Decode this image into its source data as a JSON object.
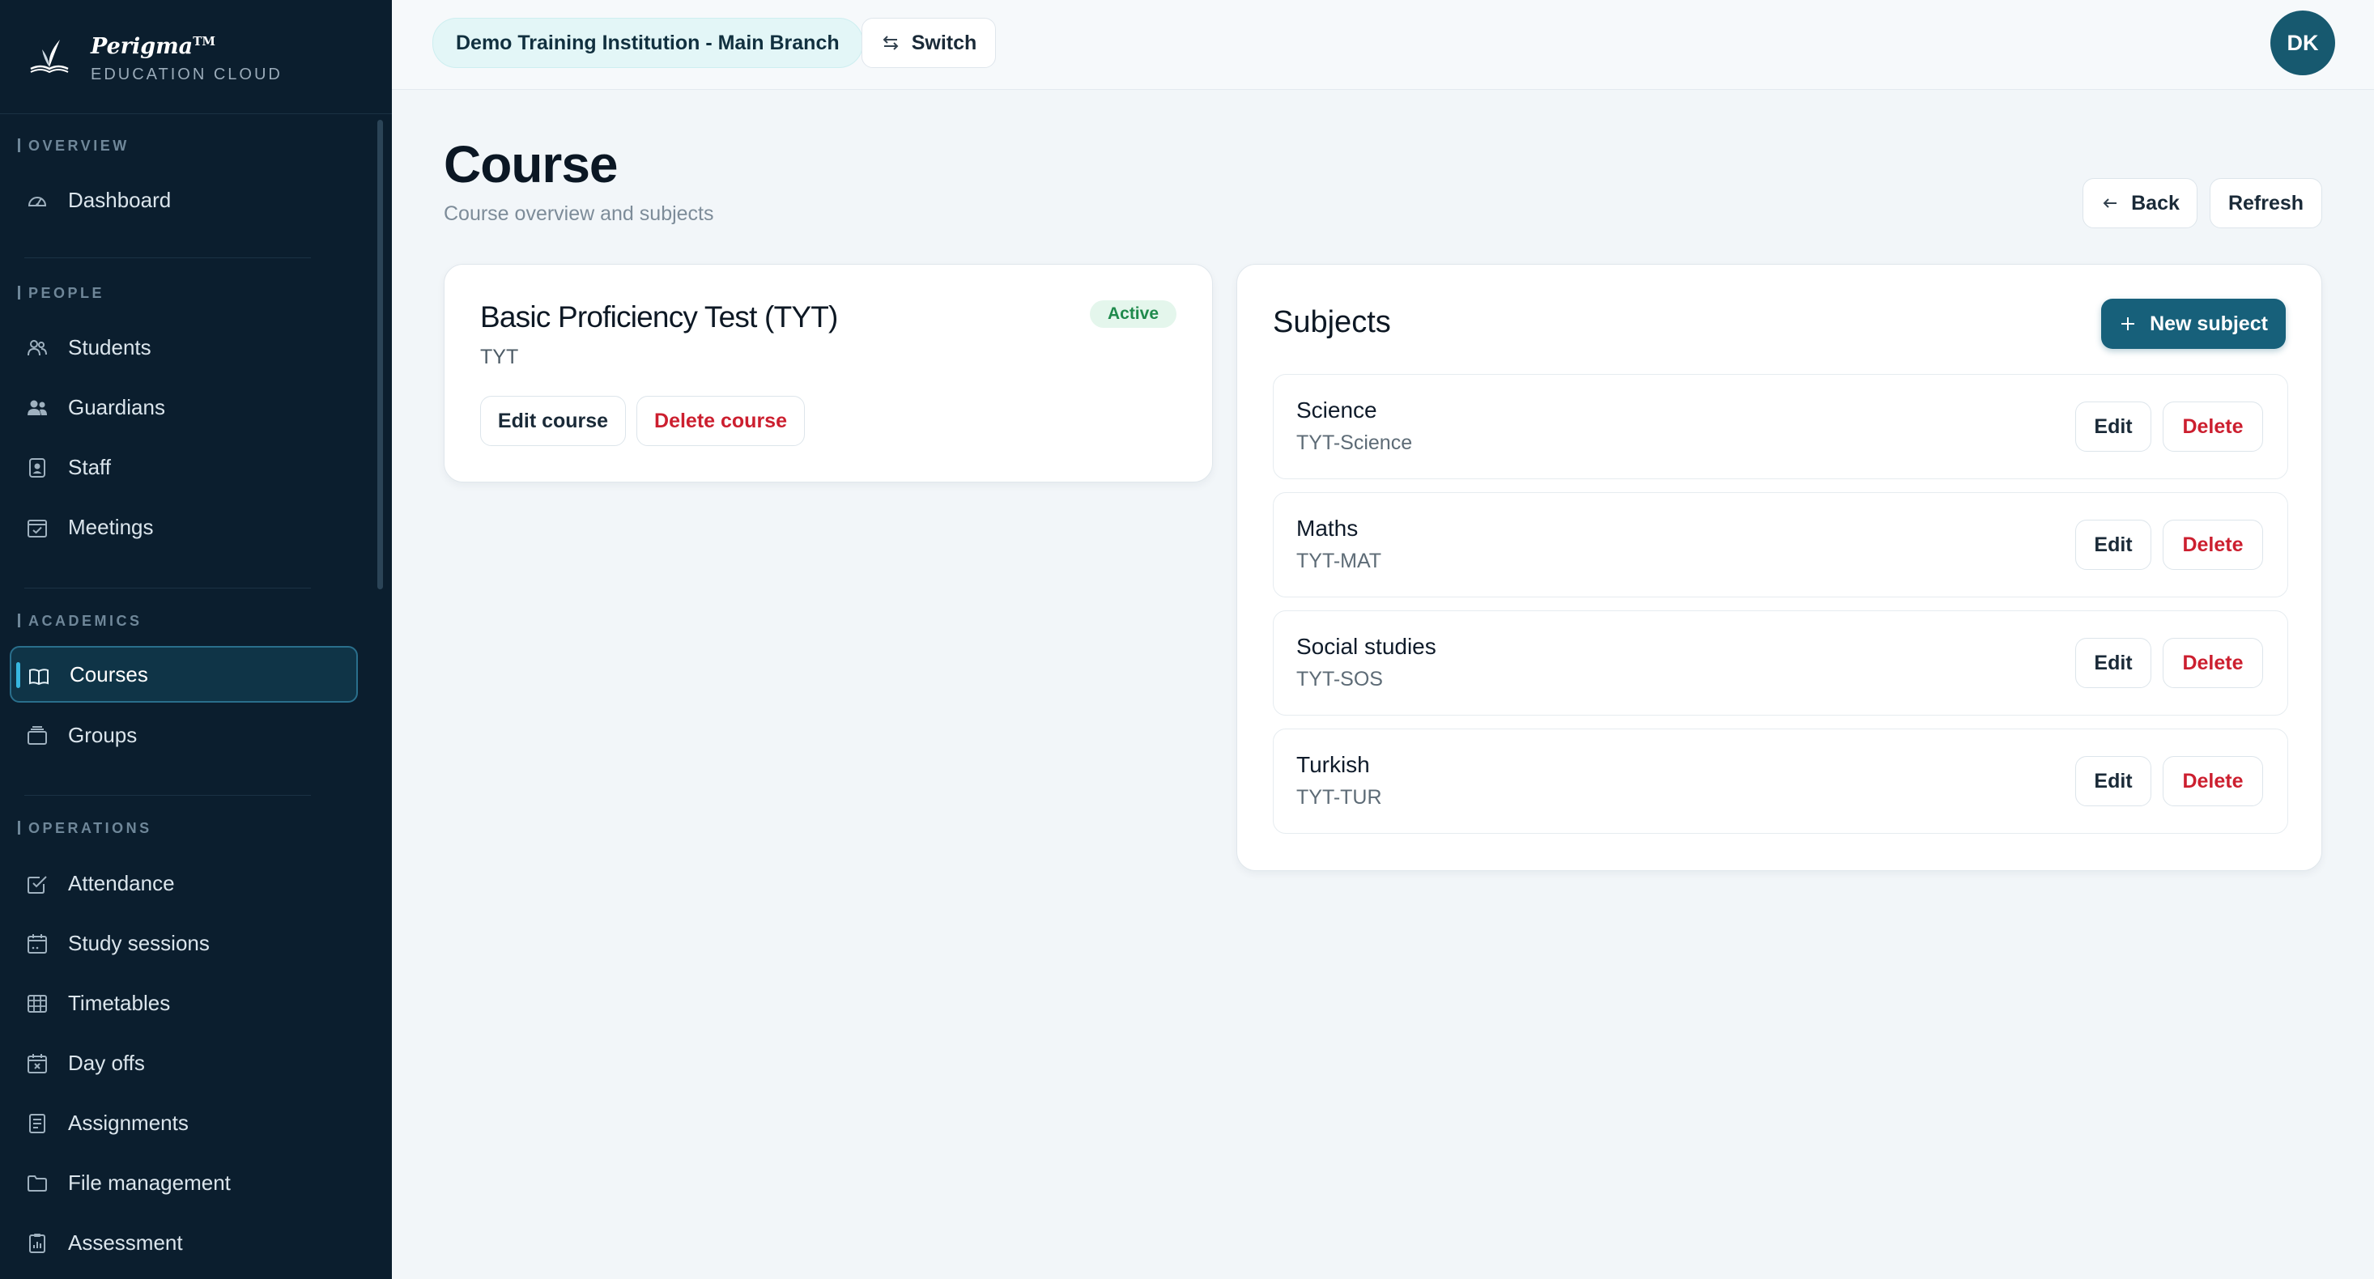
{
  "brand": {
    "name": "Perigma",
    "trademark": "TM",
    "subtitle": "EDUCATION CLOUD"
  },
  "sidebar": {
    "sections": [
      {
        "title": "OVERVIEW",
        "items": [
          {
            "label": "Dashboard",
            "icon": "gauge-icon"
          }
        ]
      },
      {
        "title": "PEOPLE",
        "items": [
          {
            "label": "Students",
            "icon": "users-icon"
          },
          {
            "label": "Guardians",
            "icon": "guardians-icon"
          },
          {
            "label": "Staff",
            "icon": "badge-icon"
          },
          {
            "label": "Meetings",
            "icon": "calendar-check-icon"
          }
        ]
      },
      {
        "title": "ACADEMICS",
        "items": [
          {
            "label": "Courses",
            "icon": "book-open-icon",
            "active": true
          },
          {
            "label": "Groups",
            "icon": "folder-stack-icon"
          }
        ]
      },
      {
        "title": "OPERATIONS",
        "items": [
          {
            "label": "Attendance",
            "icon": "check-square-icon"
          },
          {
            "label": "Study sessions",
            "icon": "calendar-icon"
          },
          {
            "label": "Timetables",
            "icon": "grid-icon"
          },
          {
            "label": "Day offs",
            "icon": "calendar-x-icon"
          },
          {
            "label": "Assignments",
            "icon": "list-doc-icon"
          },
          {
            "label": "File management",
            "icon": "folder-icon"
          },
          {
            "label": "Assessment",
            "icon": "clipboard-chart-icon"
          }
        ]
      }
    ]
  },
  "topbar": {
    "institution": "Demo Training Institution - Main Branch",
    "switch_label": "Switch",
    "avatar_initials": "DK"
  },
  "page": {
    "title": "Course",
    "subtitle": "Course overview and subjects",
    "back_label": "Back",
    "refresh_label": "Refresh"
  },
  "course": {
    "title": "Basic Proficiency Test (TYT)",
    "code": "TYT",
    "status": "Active",
    "edit_label": "Edit course",
    "delete_label": "Delete course"
  },
  "subjects": {
    "title": "Subjects",
    "new_label": "New subject",
    "edit_label": "Edit",
    "delete_label": "Delete",
    "items": [
      {
        "name": "Science",
        "code": "TYT-Science"
      },
      {
        "name": "Maths",
        "code": "TYT-MAT"
      },
      {
        "name": "Social studies",
        "code": "TYT-SOS"
      },
      {
        "name": "Turkish",
        "code": "TYT-TUR"
      }
    ]
  },
  "colors": {
    "sidebar_bg": "#0b1e2e",
    "accent": "#17607a",
    "danger": "#cc1f2f",
    "active_badge": "#1f8a4c"
  }
}
